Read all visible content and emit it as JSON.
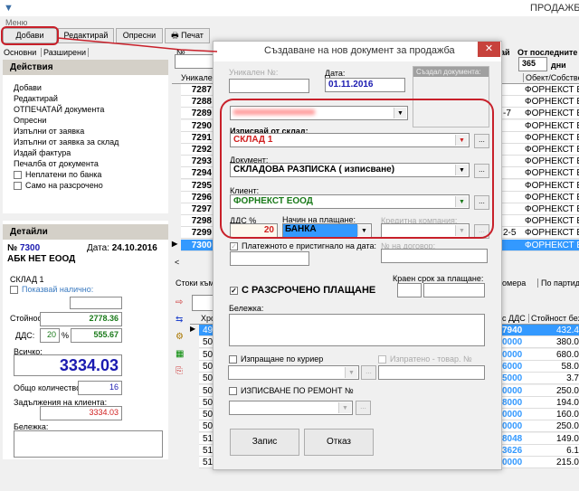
{
  "window": {
    "title": "ПРОДАЖБИ",
    "menu": "Меню"
  },
  "toolbar": {
    "add": "Добави",
    "edit": "Редактирай",
    "refresh": "Опресни",
    "print": "Печат"
  },
  "tabs": [
    "Основни",
    "Разширени"
  ],
  "actions": {
    "title": "Действия",
    "items": [
      "Добави",
      "Редактирай",
      "ОТПЕЧАТАЙ документа",
      "Опресни",
      "Изпълни от заявка",
      "Изпълни от заявка за склад",
      "Издай фактура",
      "Печалба от документа"
    ],
    "checks": [
      "Неплатени по банка",
      "Само на разсрочено"
    ]
  },
  "details": {
    "title": "Детайли",
    "no_label": "№",
    "no": "7300",
    "date_label": "Дата:",
    "date": "24.10.2016",
    "client": "АБК НЕТ ЕООД",
    "warehouse": "СКЛАД 1",
    "show_avail": "Показвай налично:",
    "value_label": "Стойност:",
    "value": "2778.36",
    "vat_label": "ДДС:",
    "vat_pct": "20",
    "pct": "%",
    "vat": "555.67",
    "total_label": "Всичко:",
    "total": "3334.03",
    "qty_label": "Общо количество:",
    "qty": "16",
    "debt_label": "Задължения на клиента:",
    "debt": "3334.03",
    "note_label": "Бележка:"
  },
  "grid": {
    "filter_label": "№",
    "col_unique": "Уникален",
    "col_object": "Обект/Собствен",
    "last_label": "ай",
    "from_last": "От последните",
    "days": "365",
    "days_unit": "дни",
    "rows": [
      "7287",
      "7288",
      "7289",
      "7290",
      "7291",
      "7292",
      "7293",
      "7294",
      "7295",
      "7296",
      "7297",
      "7298",
      "7299",
      "7300"
    ],
    "mid": [
      "",
      "",
      "-7",
      "",
      "",
      "",
      "",
      "",
      "",
      "",
      "",
      "",
      "2-5",
      ""
    ],
    "object": "ФОРНЕКСТ ЕООД",
    "selected": "7300"
  },
  "lower": {
    "tab": "Стоки към",
    "tabs_right": [
      "омера",
      "По партиди"
    ],
    "col_hron": "Хрон",
    "col_vat": "с ДДС",
    "col_novat": "Стойност без Д",
    "left": [
      "49",
      "50",
      "50",
      "50",
      "50",
      "50",
      "50",
      "50",
      "50",
      "51",
      "51",
      "51"
    ],
    "vat": [
      "7940",
      "0000",
      "0000",
      "6000",
      "5000",
      "0000",
      "8000",
      "0000",
      "0000",
      "8048",
      "3626",
      "0000"
    ],
    "novat": [
      "432.4",
      "380.0",
      "680.0",
      "58.0",
      "3.7",
      "250.0",
      "194.0",
      "160.0",
      "250.0",
      "149.0",
      "6.1",
      "215.0"
    ]
  },
  "dialog": {
    "title": "Създаване на нов документ за продажба",
    "unique_label": "Уникален №:",
    "date_label": "Дата:",
    "date": "01.11.2016",
    "creator_label": "Създал документа:",
    "warehouse_label": "Изписвай от склад:",
    "warehouse": "СКЛАД 1",
    "doc_label": "Документ:",
    "doc": "СКЛАДОВА РАЗПИСКА ( изписване)",
    "client_label": "Клиент:",
    "client": "ФОРНЕКСТ ЕООД",
    "vat_label": "ДДС %",
    "vat": "20",
    "pay_label": "Начин на плащане:",
    "pay": "БАНКА",
    "credit_label": "Кредитна компания:",
    "paid_label": "Платежното е пристигнало на дата:",
    "contract_label": "№ на договор:",
    "deadline_label": "Краен срок за плащане:",
    "installments": "С РАЗСРОЧЕНО ПЛАЩАНЕ",
    "note_label": "Бележка:",
    "courier": "Изпращане по куриер",
    "sent": "Изпратено - товар. №",
    "repair": "ИЗПИСВАНЕ ПО РЕМОНТ №",
    "save": "Запис",
    "cancel": "Отказ",
    "ellipsis": "..."
  },
  "colors": {
    "accent": "#3399ff",
    "annotation": "#c8202a",
    "total": "#1a1ab0",
    "green": "#1a7a1a",
    "red": "#d02020"
  }
}
